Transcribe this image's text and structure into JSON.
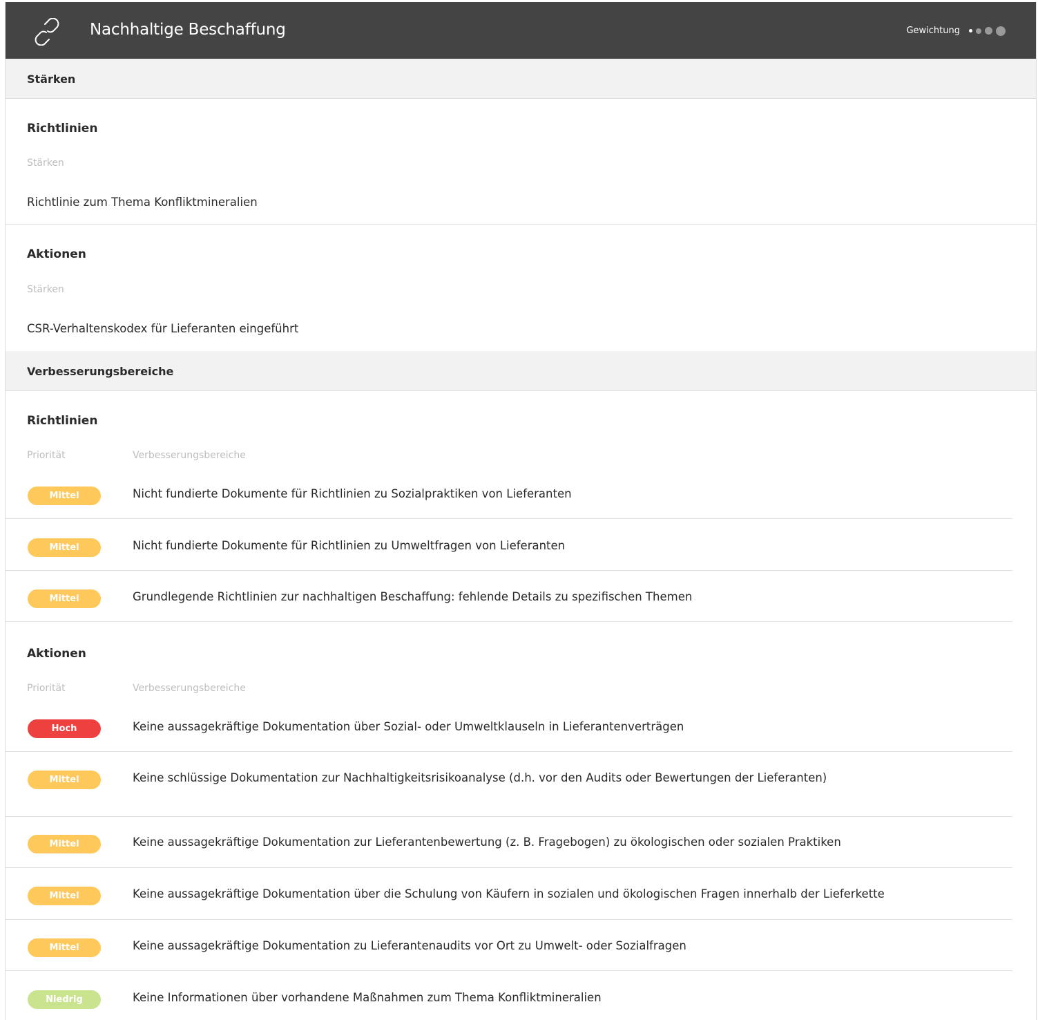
{
  "header": {
    "title": "Nachhaltige Beschaffung",
    "weight_label": "Gewichtung",
    "weight_dots": 4,
    "weight_active": 1
  },
  "colors": {
    "header_bg": "#444444",
    "band_bg": "#f2f2f2",
    "priority_medium": "#ffc85a",
    "priority_high": "#ef4040",
    "priority_low": "#c9e38e"
  },
  "strengths": {
    "heading": "Stärken",
    "groups": [
      {
        "title": "Richtlinien",
        "column_label": "Stärken",
        "items": [
          "Richtlinie zum Thema Konfliktmineralien"
        ]
      },
      {
        "title": "Aktionen",
        "column_label": "Stärken",
        "items": [
          "CSR-Verhaltenskodex für Lieferanten eingeführt"
        ]
      }
    ]
  },
  "improvements": {
    "heading": "Verbesserungsbereiche",
    "groups": [
      {
        "title": "Richtlinien",
        "col_priority": "Priorität",
        "col_area": "Verbesserungsbereiche",
        "items": [
          {
            "priority": "Mittel",
            "text": "Nicht fundierte Dokumente für Richtlinien zu Sozialpraktiken von Lieferanten"
          },
          {
            "priority": "Mittel",
            "text": "Nicht fundierte Dokumente für Richtlinien zu Umweltfragen von Lieferanten"
          },
          {
            "priority": "Mittel",
            "text": "Grundlegende Richtlinien zur nachhaltigen Beschaffung: fehlende Details zu spezifischen Themen"
          }
        ]
      },
      {
        "title": "Aktionen",
        "col_priority": "Priorität",
        "col_area": "Verbesserungsbereiche",
        "items": [
          {
            "priority": "Hoch",
            "text": "Keine aussagekräftige Dokumentation über Sozial- oder Umweltklauseln in Lieferantenverträgen"
          },
          {
            "priority": "Mittel",
            "text": "Keine schlüssige Dokumentation zur Nachhaltigkeitsrisikoanalyse (d.h. vor den Audits oder Bewertungen der Lieferanten)"
          },
          {
            "priority": "Mittel",
            "text": "Keine aussagekräftige Dokumentation zur Lieferantenbewertung (z. B. Fragebogen) zu ökologischen oder sozialen Praktiken"
          },
          {
            "priority": "Mittel",
            "text": "Keine aussagekräftige Dokumentation über die Schulung von Käufern in sozialen und ökologischen Fragen innerhalb der Lieferkette"
          },
          {
            "priority": "Mittel",
            "text": "Keine aussagekräftige Dokumentation zu Lieferantenaudits vor Ort zu Umwelt- oder Sozialfragen"
          },
          {
            "priority": "Niedrig",
            "text": "Keine Informationen über vorhandene Maßnahmen zum Thema Konfliktmineralien"
          }
        ]
      }
    ]
  }
}
